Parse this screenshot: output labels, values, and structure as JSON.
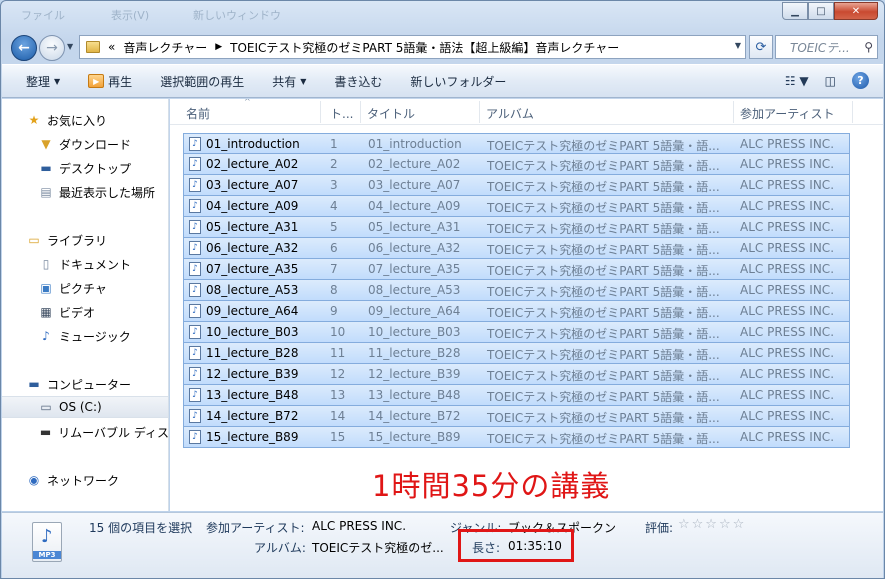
{
  "titlebar": {
    "ghost_items": [
      "ファイル",
      "表示(V)",
      "新しいウィンドウ"
    ]
  },
  "address": {
    "root": "«",
    "crumbs": [
      "音声レクチャー",
      "TOEICテスト究極のゼミPART 5語彙・語法【超上級編】音声レクチャー"
    ],
    "search_placeholder": "TOEICテ..."
  },
  "toolbar": {
    "organize": "整理",
    "play": "再生",
    "play_selection": "選択範囲の再生",
    "share": "共有",
    "burn": "書き込む",
    "new_folder": "新しいフォルダー"
  },
  "sidebar": {
    "favorites": "お気に入り",
    "downloads": "ダウンロード",
    "desktop": "デスクトップ",
    "recent": "最近表示した場所",
    "libraries": "ライブラリ",
    "documents": "ドキュメント",
    "pictures": "ピクチャ",
    "videos": "ビデオ",
    "music": "ミュージック",
    "computer": "コンピューター",
    "os_drive": "OS (C:)",
    "removable": "リムーバブル ディス",
    "network": "ネットワーク"
  },
  "columns": {
    "name": "名前",
    "number": "ト...",
    "title": "タイトル",
    "album": "アルバム",
    "artist": "参加アーティスト"
  },
  "files": [
    {
      "name": "01_introduction",
      "no": "1",
      "title": "01_introduction",
      "album": "TOEICテスト究極のゼミPART 5語彙・語...",
      "artist": "ALC PRESS INC."
    },
    {
      "name": "02_lecture_A02",
      "no": "2",
      "title": "02_lecture_A02",
      "album": "TOEICテスト究極のゼミPART 5語彙・語...",
      "artist": "ALC PRESS INC."
    },
    {
      "name": "03_lecture_A07",
      "no": "3",
      "title": "03_lecture_A07",
      "album": "TOEICテスト究極のゼミPART 5語彙・語...",
      "artist": "ALC PRESS INC."
    },
    {
      "name": "04_lecture_A09",
      "no": "4",
      "title": "04_lecture_A09",
      "album": "TOEICテスト究極のゼミPART 5語彙・語...",
      "artist": "ALC PRESS INC."
    },
    {
      "name": "05_lecture_A31",
      "no": "5",
      "title": "05_lecture_A31",
      "album": "TOEICテスト究極のゼミPART 5語彙・語...",
      "artist": "ALC PRESS INC."
    },
    {
      "name": "06_lecture_A32",
      "no": "6",
      "title": "06_lecture_A32",
      "album": "TOEICテスト究極のゼミPART 5語彙・語...",
      "artist": "ALC PRESS INC."
    },
    {
      "name": "07_lecture_A35",
      "no": "7",
      "title": "07_lecture_A35",
      "album": "TOEICテスト究極のゼミPART 5語彙・語...",
      "artist": "ALC PRESS INC."
    },
    {
      "name": "08_lecture_A53",
      "no": "8",
      "title": "08_lecture_A53",
      "album": "TOEICテスト究極のゼミPART 5語彙・語...",
      "artist": "ALC PRESS INC."
    },
    {
      "name": "09_lecture_A64",
      "no": "9",
      "title": "09_lecture_A64",
      "album": "TOEICテスト究極のゼミPART 5語彙・語...",
      "artist": "ALC PRESS INC."
    },
    {
      "name": "10_lecture_B03",
      "no": "10",
      "title": "10_lecture_B03",
      "album": "TOEICテスト究極のゼミPART 5語彙・語...",
      "artist": "ALC PRESS INC."
    },
    {
      "name": "11_lecture_B28",
      "no": "11",
      "title": "11_lecture_B28",
      "album": "TOEICテスト究極のゼミPART 5語彙・語...",
      "artist": "ALC PRESS INC."
    },
    {
      "name": "12_lecture_B39",
      "no": "12",
      "title": "12_lecture_B39",
      "album": "TOEICテスト究極のゼミPART 5語彙・語...",
      "artist": "ALC PRESS INC."
    },
    {
      "name": "13_lecture_B48",
      "no": "13",
      "title": "13_lecture_B48",
      "album": "TOEICテスト究極のゼミPART 5語彙・語...",
      "artist": "ALC PRESS INC."
    },
    {
      "name": "14_lecture_B72",
      "no": "14",
      "title": "14_lecture_B72",
      "album": "TOEICテスト究極のゼミPART 5語彙・語...",
      "artist": "ALC PRESS INC."
    },
    {
      "name": "15_lecture_B89",
      "no": "15",
      "title": "15_lecture_B89",
      "album": "TOEICテスト究極のゼミPART 5語彙・語...",
      "artist": "ALC PRESS INC."
    }
  ],
  "annotation": "1時間35分の講義",
  "details": {
    "selection": "15 個の項目を選択",
    "artist_label": "参加アーティスト:",
    "artist_value": "ALC PRESS INC.",
    "genre_label": "ジャンル:",
    "genre_value": "ブック＆スポークン",
    "rating_label": "評価:",
    "rating_stars": "☆☆☆☆☆",
    "album_label": "アルバム:",
    "album_value": "TOEICテスト究極のゼ...",
    "length_label": "長さ:",
    "length_value": "01:35:10",
    "file_icon_label": "MP3"
  },
  "colors": {
    "annotation_red": "#e01616",
    "selection_fill": "#cde3fc",
    "selection_border": "#84acdd"
  }
}
